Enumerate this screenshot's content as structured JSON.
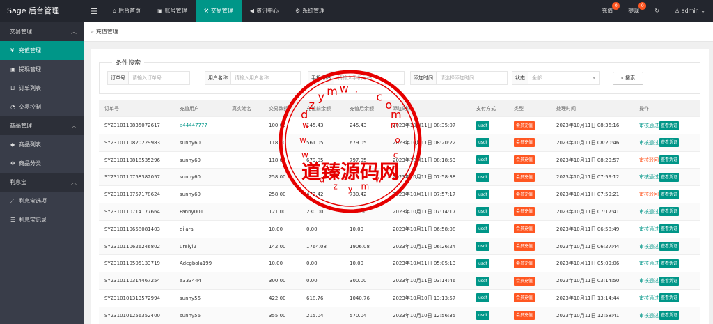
{
  "app": {
    "title": "Sage 后台管理"
  },
  "topnav": {
    "menu_icon": "hamburger-icon",
    "items": [
      {
        "label": "后台首页",
        "icon": "home-icon"
      },
      {
        "label": "账号管理",
        "icon": "id-card-icon"
      },
      {
        "label": "交易管理",
        "icon": "gavel-icon"
      },
      {
        "label": "资讯中心",
        "icon": "megaphone-icon"
      },
      {
        "label": "系统管理",
        "icon": "gears-icon"
      }
    ],
    "recharge": {
      "label": "充值",
      "count": "0"
    },
    "withdraw": {
      "label": "提现",
      "count": "0"
    },
    "user": "admin"
  },
  "sidebar": {
    "group1": "交易管理",
    "items1": [
      {
        "label": "充值管理",
        "icon": "yen-icon"
      },
      {
        "label": "提现管理",
        "icon": "money-icon"
      },
      {
        "label": "订单列表",
        "icon": "cart-icon"
      },
      {
        "label": "交易控制",
        "icon": "dashboard-icon"
      }
    ],
    "group2": "商品管理",
    "items2": [
      {
        "label": "商品列表",
        "icon": "cube-icon"
      },
      {
        "label": "商品分类",
        "icon": "cubes-icon"
      }
    ],
    "group3": "利息宝",
    "items3": [
      {
        "label": "利息宝选项",
        "icon": "line-chart-icon"
      },
      {
        "label": "利息宝记录",
        "icon": "list-icon"
      }
    ]
  },
  "breadcrumb": "充值管理",
  "filter": {
    "legend": "条件搜索",
    "order_label": "订单号",
    "order_placeholder": "请输入订单号",
    "user_label": "用户名称",
    "user_placeholder": "请输入用户名称",
    "phone_label": "手机号码",
    "phone_placeholder": "请输入手机号码",
    "time_label": "添加时间",
    "time_placeholder": "请选择添加时间",
    "status_label": "状态",
    "status_value": "全部",
    "search_label": "搜索"
  },
  "table": {
    "headers": [
      "订单号",
      "充值用户",
      "真实姓名",
      "交易数额",
      "充值前余额",
      "充值后余额",
      "添加时间",
      "支付方式",
      "类型",
      "处理时间",
      "操作"
    ],
    "rows": [
      [
        "SY2310110835072617",
        "a44447777",
        "",
        "100.00",
        "145.43",
        "245.43",
        "2023年10月11日 08:35:07",
        "usdt",
        "会员充值",
        "2023年10月11日 08:36:16",
        "审核通过"
      ],
      [
        "SY2310110820229983",
        "sunny60",
        "",
        "118.00",
        "561.05",
        "679.05",
        "2023年10月11日 08:20:22",
        "usdt",
        "会员充值",
        "2023年10月11日 08:20:46",
        "审核通过"
      ],
      [
        "SY2310110818535296",
        "sunny60",
        "",
        "118.00",
        "679.05",
        "797.05",
        "2023年10月11日 08:18:53",
        "usdt",
        "会员充值",
        "2023年10月11日 08:20:57",
        "审核驳回"
      ],
      [
        "SY2310110758382057",
        "sunny60",
        "",
        "258.00",
        "",
        "",
        "2023年10月11日 07:58:38",
        "usdt",
        "会员充值",
        "2023年10月11日 07:59:12",
        "审核通过"
      ],
      [
        "SY2310110757178624",
        "sunny60",
        "",
        "258.00",
        "472.42",
        "730.42",
        "2023年10月11日 07:57:17",
        "usdt",
        "会员充值",
        "2023年10月11日 07:59:21",
        "审核驳回"
      ],
      [
        "SY2310110714177664",
        "Fanny001",
        "",
        "121.00",
        "230.00",
        "351.00",
        "2023年10月11日 07:14:17",
        "usdt",
        "会员充值",
        "2023年10月11日 07:17:41",
        "审核通过"
      ],
      [
        "SY2310110658081403",
        "dilara",
        "",
        "10.00",
        "0.00",
        "10.00",
        "2023年10月11日 06:58:08",
        "usdt",
        "会员充值",
        "2023年10月11日 06:58:49",
        "审核通过"
      ],
      [
        "SY2310110626246802",
        "ureiyi2",
        "",
        "142.00",
        "1764.08",
        "1906.08",
        "2023年10月11日 06:26:24",
        "usdt",
        "会员充值",
        "2023年10月11日 06:27:44",
        "审核通过"
      ],
      [
        "SY2310110505133719",
        "Adegbola199",
        "",
        "10.00",
        "0.00",
        "10.00",
        "2023年10月11日 05:05:13",
        "usdt",
        "会员充值",
        "2023年10月11日 05:09:06",
        "审核通过"
      ],
      [
        "SY2310110314467254",
        "a333444",
        "",
        "300.00",
        "0.00",
        "300.00",
        "2023年10月11日 03:14:46",
        "usdt",
        "会员充值",
        "2023年10月11日 03:14:50",
        "审核通过"
      ],
      [
        "SY2310101313572994",
        "sunny56",
        "",
        "422.00",
        "618.76",
        "1040.76",
        "2023年10月10日 13:13:57",
        "usdt",
        "会员充值",
        "2023年10月11日 13:14:44",
        "审核通过"
      ],
      [
        "SY2310101256352400",
        "sunny56",
        "",
        "355.00",
        "215.04",
        "570.04",
        "2023年10月10日 12:56:35",
        "usdt",
        "会员充值",
        "2023年10月11日 12:58:41",
        "审核通过"
      ]
    ],
    "view_label": "查看凭证"
  },
  "watermark": {
    "big_text": "道臻源码网",
    "letters_top": [
      "d",
      "z",
      "y",
      "m",
      "w",
      ".",
      " ",
      "c",
      "o",
      "m"
    ],
    "letters_bottom": [
      "w",
      "w",
      "w",
      ".",
      "d",
      "z",
      "y",
      "m",
      "w",
      ".",
      "c",
      "o",
      "m"
    ]
  },
  "colors": {
    "accent": "#009688",
    "danger": "#ff5722",
    "topbar": "#23262e",
    "sidebar": "#393d49",
    "stamp": "#e60000"
  }
}
